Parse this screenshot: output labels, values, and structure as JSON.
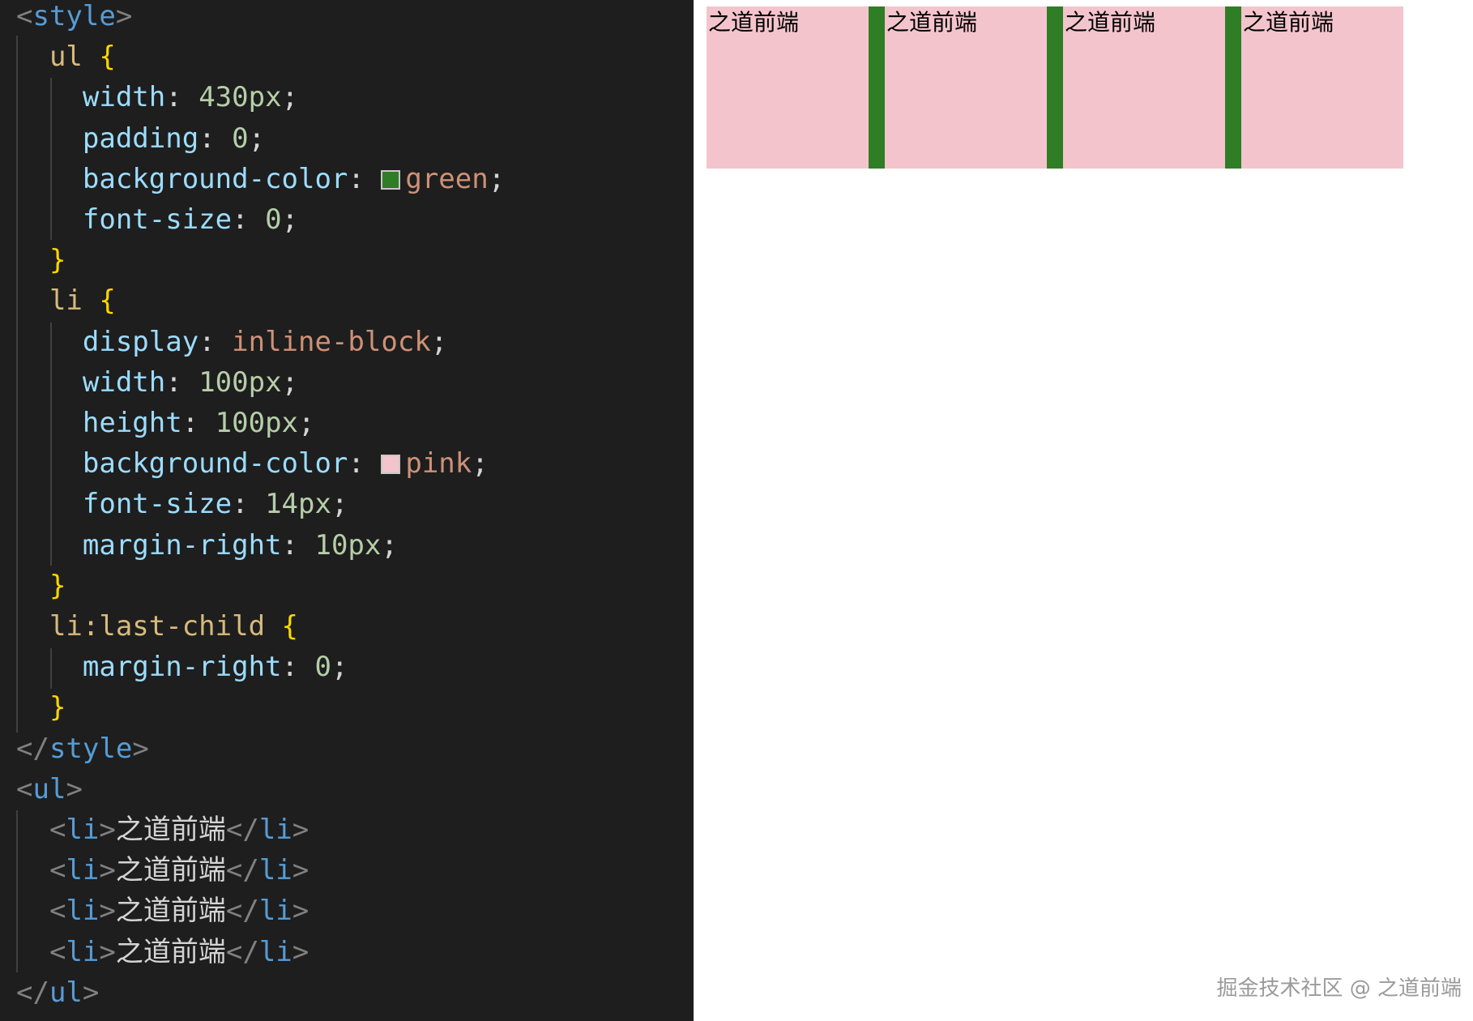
{
  "editor": {
    "colors": {
      "background": "#1e1e1e",
      "bracket": "#808080",
      "tag": "#569cd6",
      "selector": "#d7ba7d",
      "brace": "#ffd700",
      "property": "#9cdcfe",
      "number": "#b5cea8",
      "string_value": "#ce9178",
      "punctuation": "#d4d4d4",
      "text": "#d4d4d4"
    },
    "lines": [
      {
        "tokens": [
          {
            "t": "<",
            "c": "bracket"
          },
          {
            "t": "style",
            "c": "tag"
          },
          {
            "t": ">",
            "c": "bracket"
          }
        ]
      },
      {
        "tokens": [
          {
            "t": "  "
          },
          {
            "t": "ul",
            "c": "selector"
          },
          {
            "t": " "
          },
          {
            "t": "{",
            "c": "brace"
          }
        ]
      },
      {
        "tokens": [
          {
            "t": "    "
          },
          {
            "t": "width",
            "c": "property"
          },
          {
            "t": ": ",
            "c": "punctuation"
          },
          {
            "t": "430px",
            "c": "number"
          },
          {
            "t": ";",
            "c": "punctuation"
          }
        ]
      },
      {
        "tokens": [
          {
            "t": "    "
          },
          {
            "t": "padding",
            "c": "property"
          },
          {
            "t": ": ",
            "c": "punctuation"
          },
          {
            "t": "0",
            "c": "number"
          },
          {
            "t": ";",
            "c": "punctuation"
          }
        ]
      },
      {
        "tokens": [
          {
            "t": "    "
          },
          {
            "t": "background-color",
            "c": "property"
          },
          {
            "t": ": ",
            "c": "punctuation"
          },
          {
            "swatch": "#2f7d24",
            "name": "green-swatch"
          },
          {
            "t": "green",
            "c": "string_value"
          },
          {
            "t": ";",
            "c": "punctuation"
          }
        ]
      },
      {
        "tokens": [
          {
            "t": "    "
          },
          {
            "t": "font-size",
            "c": "property"
          },
          {
            "t": ": ",
            "c": "punctuation"
          },
          {
            "t": "0",
            "c": "number"
          },
          {
            "t": ";",
            "c": "punctuation"
          }
        ]
      },
      {
        "tokens": [
          {
            "t": "  "
          },
          {
            "t": "}",
            "c": "brace"
          }
        ]
      },
      {
        "tokens": [
          {
            "t": "  "
          },
          {
            "t": "li",
            "c": "selector"
          },
          {
            "t": " "
          },
          {
            "t": "{",
            "c": "brace"
          }
        ]
      },
      {
        "tokens": [
          {
            "t": "    "
          },
          {
            "t": "display",
            "c": "property"
          },
          {
            "t": ": ",
            "c": "punctuation"
          },
          {
            "t": "inline-block",
            "c": "string_value"
          },
          {
            "t": ";",
            "c": "punctuation"
          }
        ]
      },
      {
        "tokens": [
          {
            "t": "    "
          },
          {
            "t": "width",
            "c": "property"
          },
          {
            "t": ": ",
            "c": "punctuation"
          },
          {
            "t": "100px",
            "c": "number"
          },
          {
            "t": ";",
            "c": "punctuation"
          }
        ]
      },
      {
        "tokens": [
          {
            "t": "    "
          },
          {
            "t": "height",
            "c": "property"
          },
          {
            "t": ": ",
            "c": "punctuation"
          },
          {
            "t": "100px",
            "c": "number"
          },
          {
            "t": ";",
            "c": "punctuation"
          }
        ]
      },
      {
        "tokens": [
          {
            "t": "    "
          },
          {
            "t": "background-color",
            "c": "property"
          },
          {
            "t": ": ",
            "c": "punctuation"
          },
          {
            "swatch": "#f4c4cc",
            "name": "pink-swatch"
          },
          {
            "t": "pink",
            "c": "string_value"
          },
          {
            "t": ";",
            "c": "punctuation"
          }
        ]
      },
      {
        "tokens": [
          {
            "t": "    "
          },
          {
            "t": "font-size",
            "c": "property"
          },
          {
            "t": ": ",
            "c": "punctuation"
          },
          {
            "t": "14px",
            "c": "number"
          },
          {
            "t": ";",
            "c": "punctuation"
          }
        ]
      },
      {
        "tokens": [
          {
            "t": "    "
          },
          {
            "t": "margin-right",
            "c": "property"
          },
          {
            "t": ": ",
            "c": "punctuation"
          },
          {
            "t": "10px",
            "c": "number"
          },
          {
            "t": ";",
            "c": "punctuation"
          }
        ]
      },
      {
        "tokens": [
          {
            "t": "  "
          },
          {
            "t": "}",
            "c": "brace"
          }
        ]
      },
      {
        "tokens": [
          {
            "t": "  "
          },
          {
            "t": "li:last-child",
            "c": "selector"
          },
          {
            "t": " "
          },
          {
            "t": "{",
            "c": "brace"
          }
        ]
      },
      {
        "tokens": [
          {
            "t": "    "
          },
          {
            "t": "margin-right",
            "c": "property"
          },
          {
            "t": ": ",
            "c": "punctuation"
          },
          {
            "t": "0",
            "c": "number"
          },
          {
            "t": ";",
            "c": "punctuation"
          }
        ]
      },
      {
        "tokens": [
          {
            "t": "  "
          },
          {
            "t": "}",
            "c": "brace"
          }
        ]
      },
      {
        "tokens": [
          {
            "t": "</",
            "c": "bracket"
          },
          {
            "t": "style",
            "c": "tag"
          },
          {
            "t": ">",
            "c": "bracket"
          }
        ]
      },
      {
        "tokens": [
          {
            "t": "<",
            "c": "bracket"
          },
          {
            "t": "ul",
            "c": "tag"
          },
          {
            "t": ">",
            "c": "bracket"
          }
        ]
      },
      {
        "tokens": [
          {
            "t": "  "
          },
          {
            "t": "<",
            "c": "bracket"
          },
          {
            "t": "li",
            "c": "tag"
          },
          {
            "t": ">",
            "c": "bracket"
          },
          {
            "t": "之道前端",
            "c": "text"
          },
          {
            "t": "</",
            "c": "bracket"
          },
          {
            "t": "li",
            "c": "tag"
          },
          {
            "t": ">",
            "c": "bracket"
          }
        ]
      },
      {
        "tokens": [
          {
            "t": "  "
          },
          {
            "t": "<",
            "c": "bracket"
          },
          {
            "t": "li",
            "c": "tag"
          },
          {
            "t": ">",
            "c": "bracket"
          },
          {
            "t": "之道前端",
            "c": "text"
          },
          {
            "t": "</",
            "c": "bracket"
          },
          {
            "t": "li",
            "c": "tag"
          },
          {
            "t": ">",
            "c": "bracket"
          }
        ]
      },
      {
        "tokens": [
          {
            "t": "  "
          },
          {
            "t": "<",
            "c": "bracket"
          },
          {
            "t": "li",
            "c": "tag"
          },
          {
            "t": ">",
            "c": "bracket"
          },
          {
            "t": "之道前端",
            "c": "text"
          },
          {
            "t": "</",
            "c": "bracket"
          },
          {
            "t": "li",
            "c": "tag"
          },
          {
            "t": ">",
            "c": "bracket"
          }
        ]
      },
      {
        "tokens": [
          {
            "t": "  "
          },
          {
            "t": "<",
            "c": "bracket"
          },
          {
            "t": "li",
            "c": "tag"
          },
          {
            "t": ">",
            "c": "bracket"
          },
          {
            "t": "之道前端",
            "c": "text"
          },
          {
            "t": "</",
            "c": "bracket"
          },
          {
            "t": "li",
            "c": "tag"
          },
          {
            "t": ">",
            "c": "bracket"
          }
        ]
      },
      {
        "tokens": [
          {
            "t": "</",
            "c": "bracket"
          },
          {
            "t": "ul",
            "c": "tag"
          },
          {
            "t": ">",
            "c": "bracket"
          }
        ]
      }
    ]
  },
  "preview": {
    "ul_color": "#2f7d24",
    "li_color": "#f4c4cc",
    "items": [
      "之道前端",
      "之道前端",
      "之道前端",
      "之道前端"
    ]
  },
  "watermark": "掘金技术社区 @ 之道前端"
}
